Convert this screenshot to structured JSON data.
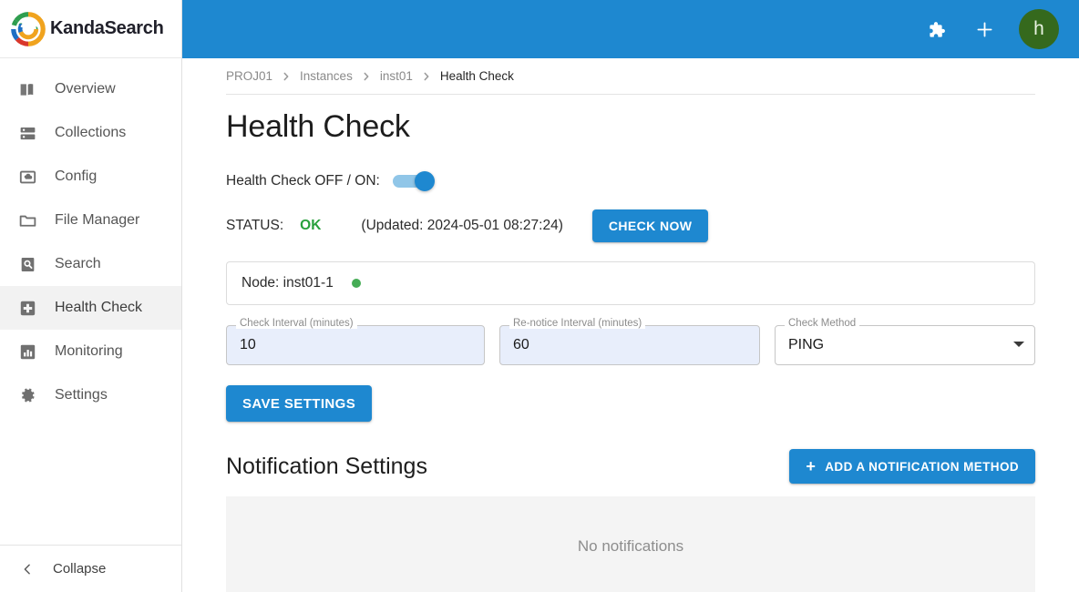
{
  "brand": {
    "name": "KandaSearch",
    "logo_icon": "kanda-swirl-logo",
    "logo_colors": {
      "green": "#2f9e4f",
      "orange": "#f0a31e",
      "blue": "#1e6fc4",
      "red": "#d9372b"
    }
  },
  "theme": {
    "primary": "#1e88d0",
    "status_ok": "#28a03c",
    "node_dot": "#45ac55",
    "avatar_bg": "#35691d"
  },
  "sidebar": {
    "items": [
      {
        "label": "Overview",
        "icon": "book-icon",
        "active": false
      },
      {
        "label": "Collections",
        "icon": "server-stack-icon",
        "active": false
      },
      {
        "label": "Config",
        "icon": "cloud-box-icon",
        "active": false
      },
      {
        "label": "File Manager",
        "icon": "folder-icon",
        "active": false
      },
      {
        "label": "Search",
        "icon": "document-search-icon",
        "active": false
      },
      {
        "label": "Health Check",
        "icon": "health-plus-icon",
        "active": true
      },
      {
        "label": "Monitoring",
        "icon": "bar-chart-icon",
        "active": false
      },
      {
        "label": "Settings",
        "icon": "gear-icon",
        "active": false
      }
    ],
    "collapse_label": "Collapse",
    "collapse_icon": "chevron-left-icon"
  },
  "topbar": {
    "extensions_icon": "puzzle-piece-icon",
    "add_icon": "plus-icon",
    "avatar_initial": "h"
  },
  "breadcrumb": {
    "items": [
      "PROJ01",
      "Instances",
      "inst01",
      "Health Check"
    ],
    "separator": "chevron-right-icon"
  },
  "page": {
    "title": "Health Check"
  },
  "health_check": {
    "toggle_label": "Health Check OFF / ON:",
    "toggle_on": true,
    "status_key": "STATUS:",
    "status_value": "OK",
    "status_updated": "(Updated: 2024-05-01 08:27:24)",
    "check_now_label": "CHECK NOW",
    "node_label": "Node: inst01-1",
    "node_status": "online",
    "fields": [
      {
        "legend": "Check Interval (minutes)",
        "value": "10",
        "type": "text",
        "filled": true
      },
      {
        "legend": "Re-notice Interval (minutes)",
        "value": "60",
        "type": "text",
        "filled": true
      },
      {
        "legend": "Check Method",
        "value": "PING",
        "type": "select",
        "filled": false
      }
    ],
    "save_label": "SAVE SETTINGS"
  },
  "notifications": {
    "section_title": "Notification Settings",
    "add_button_label": "ADD A NOTIFICATION METHOD",
    "add_button_icon": "plus-icon",
    "empty_text": "No notifications"
  }
}
